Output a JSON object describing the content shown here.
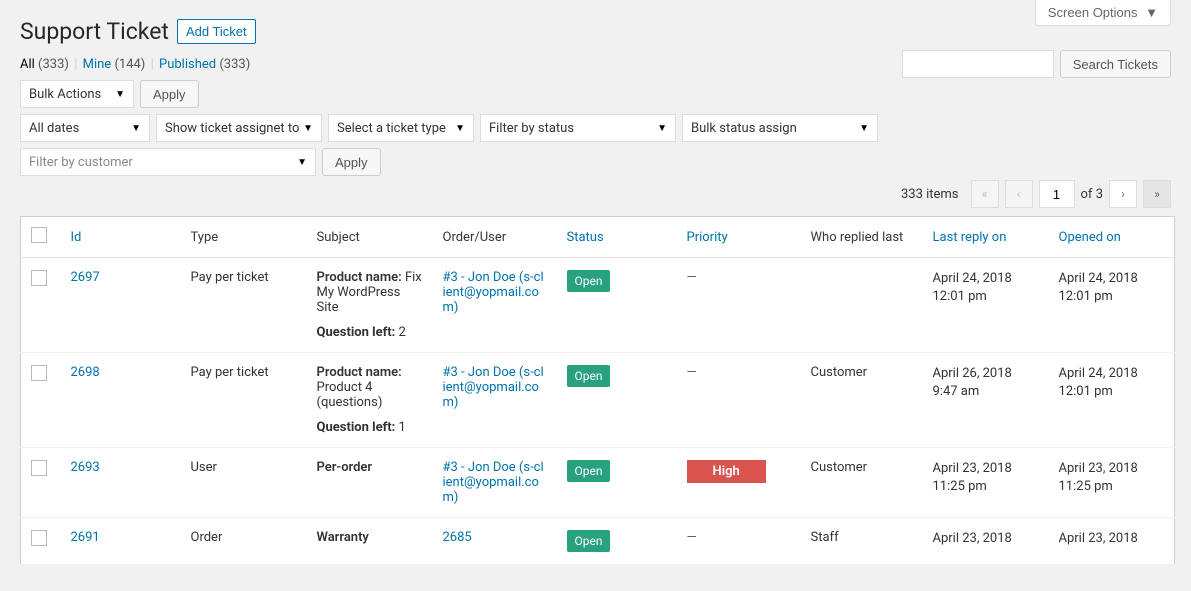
{
  "screen_options_label": "Screen Options",
  "page_title": "Support Ticket",
  "add_button_label": "Add Ticket",
  "filters": {
    "all_label": "All",
    "all_count": "(333)",
    "mine_label": "Mine",
    "mine_count": "(144)",
    "published_label": "Published",
    "published_count": "(333)"
  },
  "search": {
    "button_label": "Search Tickets",
    "value": ""
  },
  "bulk_actions": {
    "select_label": "Bulk Actions",
    "apply_label": "Apply"
  },
  "filter_row": {
    "all_dates": "All dates",
    "assignee": "Show ticket assignet to",
    "ticket_type": "Select a ticket type",
    "filter_status": "Filter by status",
    "bulk_status": "Bulk status assign",
    "filter_customer_placeholder": "Filter by customer",
    "apply_label": "Apply"
  },
  "pagination": {
    "items_text": "333 items",
    "current": "1",
    "total": "3",
    "of_label": "of"
  },
  "columns": {
    "id": "Id",
    "type": "Type",
    "subject": "Subject",
    "order_user": "Order/User",
    "status": "Status",
    "priority": "Priority",
    "who": "Who replied last",
    "last_reply": "Last reply on",
    "opened": "Opened on"
  },
  "rows": [
    {
      "id": "2697",
      "type": "Pay per ticket",
      "subject_product_label": "Product name:",
      "subject_product_value": "Fix My WordPress Site",
      "question_left_label": "Question left:",
      "question_left_value": "2",
      "order_user": "#3 - Jon Doe (s-client@yopmail.com)",
      "status": "Open",
      "priority": "—",
      "priority_high": false,
      "who": "",
      "last_reply": "April 24, 2018 12:01 pm",
      "opened": "April 24, 2018 12:01 pm"
    },
    {
      "id": "2698",
      "type": "Pay per ticket",
      "subject_product_label": "Product name:",
      "subject_product_value": "Product 4 (questions)",
      "question_left_label": "Question left:",
      "question_left_value": "1",
      "order_user": "#3 - Jon Doe (s-client@yopmail.com)",
      "status": "Open",
      "priority": "—",
      "priority_high": false,
      "who": "Customer",
      "last_reply": "April 26, 2018 9:47 am",
      "opened": "April 24, 2018 12:01 pm"
    },
    {
      "id": "2693",
      "type": "User",
      "subject_product_label": "",
      "subject_bold": "Per-order",
      "subject_product_value": "",
      "question_left_label": "",
      "question_left_value": "",
      "order_user": "#3 - Jon Doe (s-client@yopmail.com)",
      "status": "Open",
      "priority": "High",
      "priority_high": true,
      "who": "Customer",
      "last_reply": "April 23, 2018 11:25 pm",
      "opened": "April 23, 2018 11:25 pm"
    },
    {
      "id": "2691",
      "type": "Order",
      "subject_product_label": "",
      "subject_bold": "Warranty",
      "subject_product_value": "",
      "question_left_label": "",
      "question_left_value": "",
      "order_user": "2685",
      "status": "Open",
      "priority": "—",
      "priority_high": false,
      "who": "Staff",
      "last_reply": "April 23, 2018",
      "opened": "April 23, 2018"
    }
  ]
}
